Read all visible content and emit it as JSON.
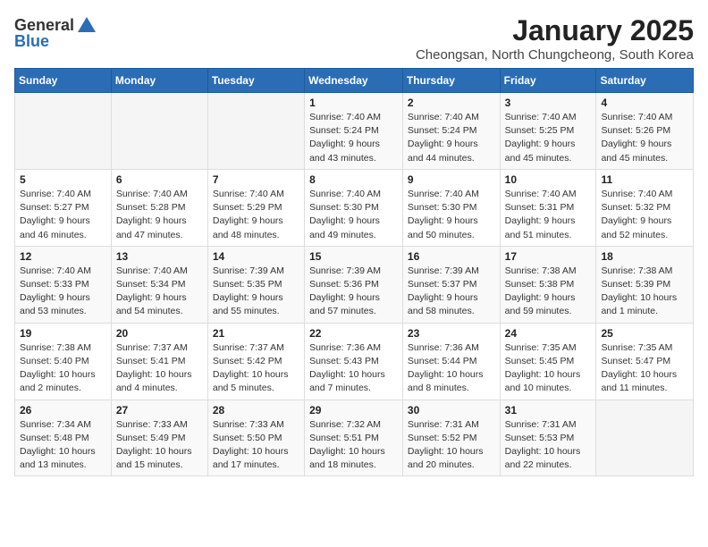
{
  "logo": {
    "general": "General",
    "blue": "Blue"
  },
  "header": {
    "title": "January 2025",
    "subtitle": "Cheongsan, North Chungcheong, South Korea"
  },
  "weekdays": [
    "Sunday",
    "Monday",
    "Tuesday",
    "Wednesday",
    "Thursday",
    "Friday",
    "Saturday"
  ],
  "weeks": [
    [
      {
        "day": "",
        "info": ""
      },
      {
        "day": "",
        "info": ""
      },
      {
        "day": "",
        "info": ""
      },
      {
        "day": "1",
        "info": "Sunrise: 7:40 AM\nSunset: 5:24 PM\nDaylight: 9 hours\nand 43 minutes."
      },
      {
        "day": "2",
        "info": "Sunrise: 7:40 AM\nSunset: 5:24 PM\nDaylight: 9 hours\nand 44 minutes."
      },
      {
        "day": "3",
        "info": "Sunrise: 7:40 AM\nSunset: 5:25 PM\nDaylight: 9 hours\nand 45 minutes."
      },
      {
        "day": "4",
        "info": "Sunrise: 7:40 AM\nSunset: 5:26 PM\nDaylight: 9 hours\nand 45 minutes."
      }
    ],
    [
      {
        "day": "5",
        "info": "Sunrise: 7:40 AM\nSunset: 5:27 PM\nDaylight: 9 hours\nand 46 minutes."
      },
      {
        "day": "6",
        "info": "Sunrise: 7:40 AM\nSunset: 5:28 PM\nDaylight: 9 hours\nand 47 minutes."
      },
      {
        "day": "7",
        "info": "Sunrise: 7:40 AM\nSunset: 5:29 PM\nDaylight: 9 hours\nand 48 minutes."
      },
      {
        "day": "8",
        "info": "Sunrise: 7:40 AM\nSunset: 5:30 PM\nDaylight: 9 hours\nand 49 minutes."
      },
      {
        "day": "9",
        "info": "Sunrise: 7:40 AM\nSunset: 5:30 PM\nDaylight: 9 hours\nand 50 minutes."
      },
      {
        "day": "10",
        "info": "Sunrise: 7:40 AM\nSunset: 5:31 PM\nDaylight: 9 hours\nand 51 minutes."
      },
      {
        "day": "11",
        "info": "Sunrise: 7:40 AM\nSunset: 5:32 PM\nDaylight: 9 hours\nand 52 minutes."
      }
    ],
    [
      {
        "day": "12",
        "info": "Sunrise: 7:40 AM\nSunset: 5:33 PM\nDaylight: 9 hours\nand 53 minutes."
      },
      {
        "day": "13",
        "info": "Sunrise: 7:40 AM\nSunset: 5:34 PM\nDaylight: 9 hours\nand 54 minutes."
      },
      {
        "day": "14",
        "info": "Sunrise: 7:39 AM\nSunset: 5:35 PM\nDaylight: 9 hours\nand 55 minutes."
      },
      {
        "day": "15",
        "info": "Sunrise: 7:39 AM\nSunset: 5:36 PM\nDaylight: 9 hours\nand 57 minutes."
      },
      {
        "day": "16",
        "info": "Sunrise: 7:39 AM\nSunset: 5:37 PM\nDaylight: 9 hours\nand 58 minutes."
      },
      {
        "day": "17",
        "info": "Sunrise: 7:38 AM\nSunset: 5:38 PM\nDaylight: 9 hours\nand 59 minutes."
      },
      {
        "day": "18",
        "info": "Sunrise: 7:38 AM\nSunset: 5:39 PM\nDaylight: 10 hours\nand 1 minute."
      }
    ],
    [
      {
        "day": "19",
        "info": "Sunrise: 7:38 AM\nSunset: 5:40 PM\nDaylight: 10 hours\nand 2 minutes."
      },
      {
        "day": "20",
        "info": "Sunrise: 7:37 AM\nSunset: 5:41 PM\nDaylight: 10 hours\nand 4 minutes."
      },
      {
        "day": "21",
        "info": "Sunrise: 7:37 AM\nSunset: 5:42 PM\nDaylight: 10 hours\nand 5 minutes."
      },
      {
        "day": "22",
        "info": "Sunrise: 7:36 AM\nSunset: 5:43 PM\nDaylight: 10 hours\nand 7 minutes."
      },
      {
        "day": "23",
        "info": "Sunrise: 7:36 AM\nSunset: 5:44 PM\nDaylight: 10 hours\nand 8 minutes."
      },
      {
        "day": "24",
        "info": "Sunrise: 7:35 AM\nSunset: 5:45 PM\nDaylight: 10 hours\nand 10 minutes."
      },
      {
        "day": "25",
        "info": "Sunrise: 7:35 AM\nSunset: 5:47 PM\nDaylight: 10 hours\nand 11 minutes."
      }
    ],
    [
      {
        "day": "26",
        "info": "Sunrise: 7:34 AM\nSunset: 5:48 PM\nDaylight: 10 hours\nand 13 minutes."
      },
      {
        "day": "27",
        "info": "Sunrise: 7:33 AM\nSunset: 5:49 PM\nDaylight: 10 hours\nand 15 minutes."
      },
      {
        "day": "28",
        "info": "Sunrise: 7:33 AM\nSunset: 5:50 PM\nDaylight: 10 hours\nand 17 minutes."
      },
      {
        "day": "29",
        "info": "Sunrise: 7:32 AM\nSunset: 5:51 PM\nDaylight: 10 hours\nand 18 minutes."
      },
      {
        "day": "30",
        "info": "Sunrise: 7:31 AM\nSunset: 5:52 PM\nDaylight: 10 hours\nand 20 minutes."
      },
      {
        "day": "31",
        "info": "Sunrise: 7:31 AM\nSunset: 5:53 PM\nDaylight: 10 hours\nand 22 minutes."
      },
      {
        "day": "",
        "info": ""
      }
    ]
  ]
}
